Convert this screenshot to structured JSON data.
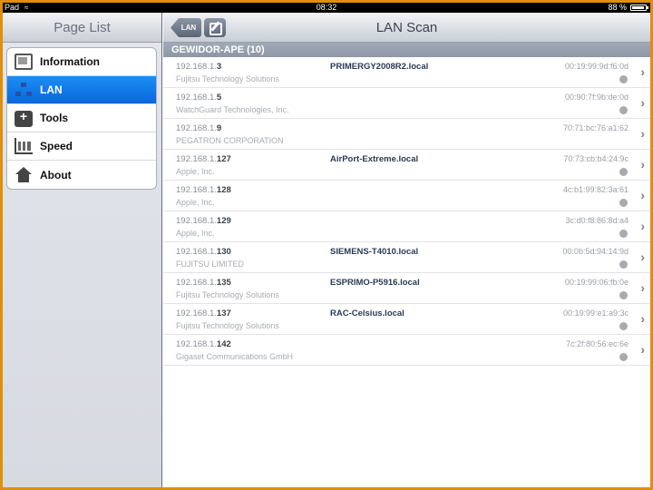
{
  "status": {
    "carrier": "Pad",
    "time": "08:32",
    "battery": "88 %"
  },
  "left": {
    "title": "Page List",
    "items": [
      {
        "label": "Information",
        "icon": "information-icon",
        "selected": false
      },
      {
        "label": "LAN",
        "icon": "lan-icon",
        "selected": true
      },
      {
        "label": "Tools",
        "icon": "tools-icon",
        "selected": false
      },
      {
        "label": "Speed",
        "icon": "speed-icon",
        "selected": false
      },
      {
        "label": "About",
        "icon": "home-icon",
        "selected": false
      }
    ]
  },
  "right": {
    "back_label": "LAN",
    "title": "LAN Scan",
    "section": "GEWIDOR-APE (10)",
    "rows": [
      {
        "ip_prefix": "192.168.1.",
        "ip_suffix": "3",
        "vendor": "Fujitsu Technology Solutions",
        "host": "PRIMERGY2008R2.local",
        "mac": "00:19:99:9d:f6:0d",
        "status_dot": true
      },
      {
        "ip_prefix": "192.168.1.",
        "ip_suffix": "5",
        "vendor": "WatchGuard Technologies, Inc.",
        "host": "",
        "mac": "00:90:7f:9b:de:0d",
        "status_dot": true
      },
      {
        "ip_prefix": "192.168.1.",
        "ip_suffix": "9",
        "vendor": "PEGATRON CORPORATION",
        "host": "",
        "mac": "70:71:bc:76:a1:62",
        "status_dot": false
      },
      {
        "ip_prefix": "192.168.1.",
        "ip_suffix": "127",
        "vendor": "Apple, Inc.",
        "host": "AirPort-Extreme.local",
        "mac": "70:73:cb:b4:24:9c",
        "status_dot": true
      },
      {
        "ip_prefix": "192.168.1.",
        "ip_suffix": "128",
        "vendor": "Apple, Inc.",
        "host": "",
        "mac": "4c:b1:99:82:3a:61",
        "status_dot": true
      },
      {
        "ip_prefix": "192.168.1.",
        "ip_suffix": "129",
        "vendor": "Apple, Inc.",
        "host": "",
        "mac": "3c:d0:f8:86:8d:a4",
        "status_dot": true
      },
      {
        "ip_prefix": "192.168.1.",
        "ip_suffix": "130",
        "vendor": "FUJITSU LIMITED",
        "host": "SIEMENS-T4010.local",
        "mac": "00:0b:5d:94:14:9d",
        "status_dot": true
      },
      {
        "ip_prefix": "192.168.1.",
        "ip_suffix": "135",
        "vendor": "Fujitsu Technology Solutions",
        "host": "ESPRIMO-P5916.local",
        "mac": "00:19:99:06:fb:0e",
        "status_dot": true
      },
      {
        "ip_prefix": "192.168.1.",
        "ip_suffix": "137",
        "vendor": "Fujitsu Technology Solutions",
        "host": "RAC-Celsius.local",
        "mac": "00:19:99:e1:a9:3c",
        "status_dot": true
      },
      {
        "ip_prefix": "192.168.1.",
        "ip_suffix": "142",
        "vendor": "Gigaset Communications GmbH",
        "host": "",
        "mac": "7c:2f:80:56:ec:6e",
        "status_dot": true
      }
    ]
  }
}
